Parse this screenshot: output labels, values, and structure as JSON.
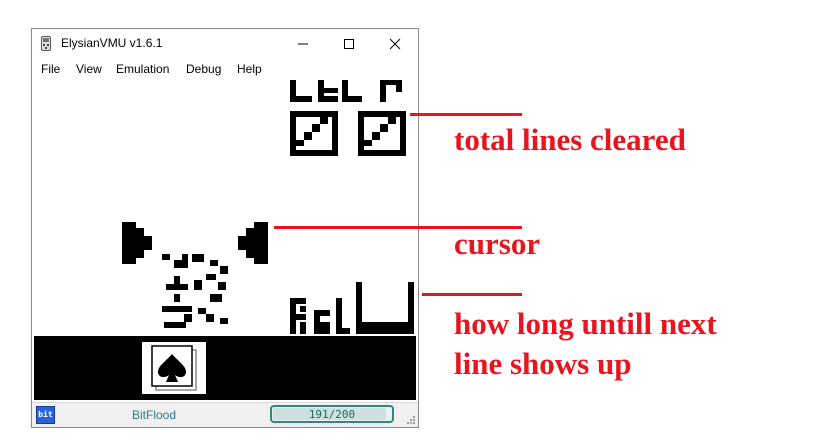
{
  "window": {
    "title": "ElysianVMU v1.6.1",
    "icon": "vmu-device-icon"
  },
  "menu": {
    "items": [
      "File",
      "View",
      "Emulation",
      "Debug",
      "Help"
    ]
  },
  "controls": {
    "minimize": "minimize-icon",
    "maximize": "maximize-icon",
    "close": "close-icon"
  },
  "game": {
    "icon": "spade-card-icon"
  },
  "status": {
    "logo_text": "bit",
    "game_name": "BitFlood",
    "counter": "191/200",
    "counter_fraction": 0.955
  },
  "annotations": [
    {
      "text": "total lines cleared"
    },
    {
      "text": "cursor"
    },
    {
      "text": "how long untill next"
    },
    {
      "text": "line shows up"
    }
  ],
  "colors": {
    "annotation": "#e8141e",
    "status_accent": "#2f8a7e",
    "game_pixel": "#000000"
  }
}
